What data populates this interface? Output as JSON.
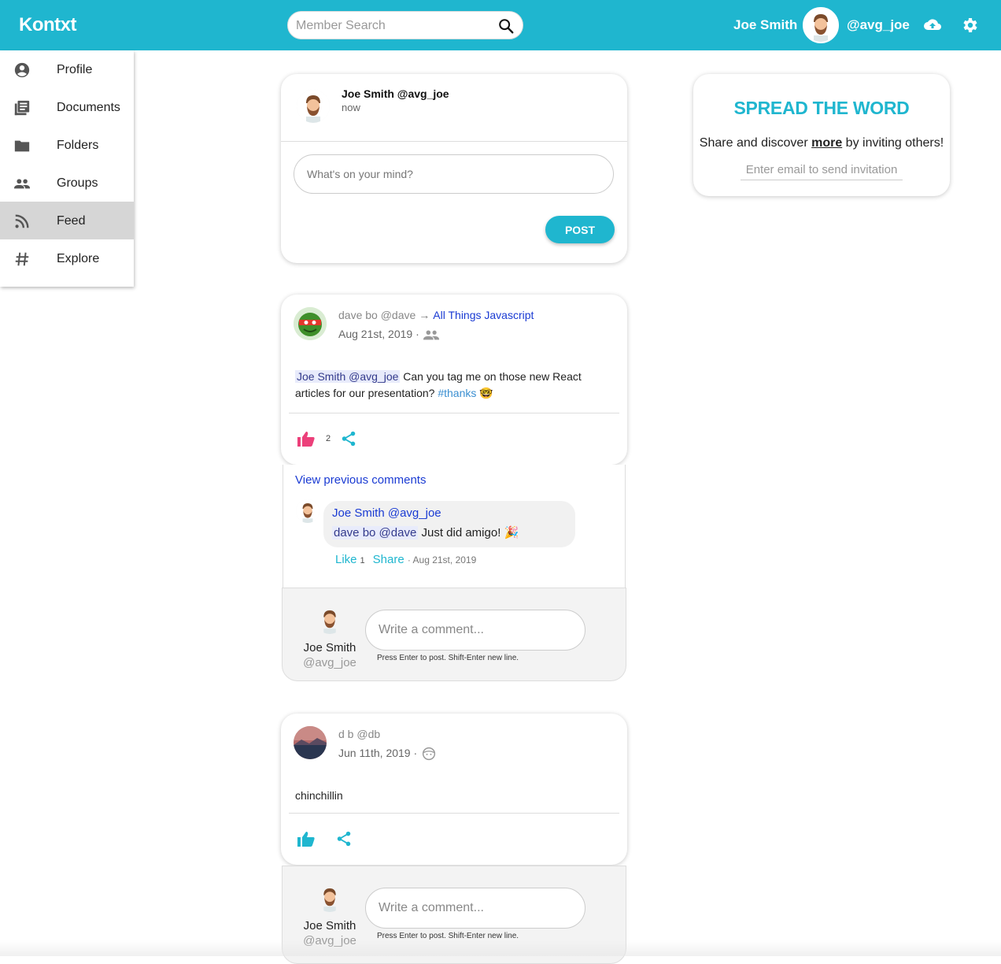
{
  "header": {
    "logo": "Kontxt",
    "search_placeholder": "Member Search",
    "user_name": "Joe Smith",
    "user_handle": "@avg_joe",
    "accent_color": "#1fb6cf"
  },
  "sidebar": {
    "items": [
      {
        "label": "Profile",
        "icon": "account-circle-icon"
      },
      {
        "label": "Documents",
        "icon": "documents-icon"
      },
      {
        "label": "Folders",
        "icon": "folder-icon"
      },
      {
        "label": "Groups",
        "icon": "groups-icon"
      },
      {
        "label": "Feed",
        "icon": "rss-feed-icon",
        "active": true
      },
      {
        "label": "Explore",
        "icon": "hashtag-icon"
      }
    ]
  },
  "composer": {
    "author": "Joe Smith @avg_joe",
    "time": "now",
    "placeholder": "What's on your mind?",
    "post_label": "POST"
  },
  "spread": {
    "title": "SPREAD THE WORD",
    "text_before": "Share and discover ",
    "text_bold": "more",
    "text_after": " by inviting others!",
    "email_placeholder": "Enter email to send invitation"
  },
  "posts": [
    {
      "author": "dave bo @dave",
      "arrow": "→",
      "group": "All Things Javascript",
      "date": "Aug 21st, 2019 ·",
      "mention": "Joe Smith @avg_joe",
      "body": " Can you tag me on those new React articles for our presentation? ",
      "hashtag": "#thanks",
      "emoji": "🤓",
      "like_count": "2",
      "like_color": "#ec407a",
      "view_previous": "View previous comments",
      "comment": {
        "author": "Joe Smith @avg_joe",
        "mention": "dave bo @dave",
        "text": " Just did amigo! 🎉",
        "like_label": "Like",
        "like_count": "1",
        "share_label": "Share",
        "date": "· Aug 21st, 2019"
      }
    },
    {
      "author": "d b @db",
      "date": "Jun 11th, 2019 ·",
      "body": "chinchillin",
      "like_color": "#1fb6cf"
    }
  ],
  "comment_box": {
    "name": "Joe Smith",
    "handle": "@avg_joe",
    "placeholder": "Write a comment...",
    "hint": "Press Enter to post. Shift-Enter new line."
  }
}
